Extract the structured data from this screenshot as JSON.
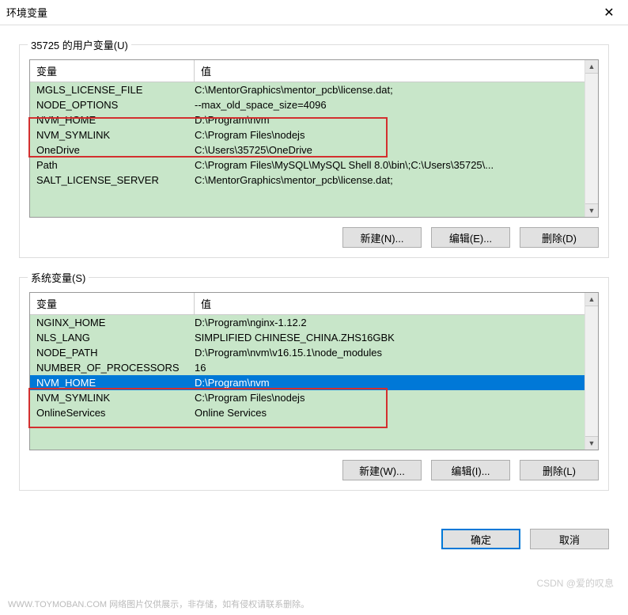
{
  "window": {
    "title": "环境变量",
    "close": "✕"
  },
  "user_section": {
    "label": "35725 的用户变量(U)",
    "headers": {
      "var": "变量",
      "val": "值"
    },
    "rows": [
      {
        "var": "MGLS_LICENSE_FILE",
        "val": "C:\\MentorGraphics\\mentor_pcb\\license.dat;"
      },
      {
        "var": "NODE_OPTIONS",
        "val": "--max_old_space_size=4096"
      },
      {
        "var": "NVM_HOME",
        "val": "D:\\Program\\nvm"
      },
      {
        "var": "NVM_SYMLINK",
        "val": "C:\\Program Files\\nodejs"
      },
      {
        "var": "OneDrive",
        "val": "C:\\Users\\35725\\OneDrive"
      },
      {
        "var": "Path",
        "val": "C:\\Program Files\\MySQL\\MySQL Shell 8.0\\bin\\;C:\\Users\\35725\\..."
      },
      {
        "var": "SALT_LICENSE_SERVER",
        "val": "C:\\MentorGraphics\\mentor_pcb\\license.dat;"
      }
    ],
    "buttons": {
      "new": "新建(N)...",
      "edit": "编辑(E)...",
      "delete": "删除(D)"
    }
  },
  "system_section": {
    "label": "系统变量(S)",
    "headers": {
      "var": "变量",
      "val": "值"
    },
    "rows": [
      {
        "var": "NGINX_HOME",
        "val": "D:\\Program\\nginx-1.12.2"
      },
      {
        "var": "NLS_LANG",
        "val": "SIMPLIFIED CHINESE_CHINA.ZHS16GBK"
      },
      {
        "var": "NODE_PATH",
        "val": "D:\\Program\\nvm\\v16.15.1\\node_modules"
      },
      {
        "var": "NUMBER_OF_PROCESSORS",
        "val": "16"
      },
      {
        "var": "NVM_HOME",
        "val": "D:\\Program\\nvm",
        "selected": true
      },
      {
        "var": "NVM_SYMLINK",
        "val": "C:\\Program Files\\nodejs"
      },
      {
        "var": "OnlineServices",
        "val": "Online Services"
      }
    ],
    "buttons": {
      "new": "新建(W)...",
      "edit": "编辑(I)...",
      "delete": "删除(L)"
    }
  },
  "dialog": {
    "ok": "确定",
    "cancel": "取消"
  },
  "watermark": {
    "left": "WWW.TOYMOBAN.COM 网络图片仅供展示，非存储，如有侵权请联系删除。",
    "right": "CSDN @爱的叹息"
  }
}
